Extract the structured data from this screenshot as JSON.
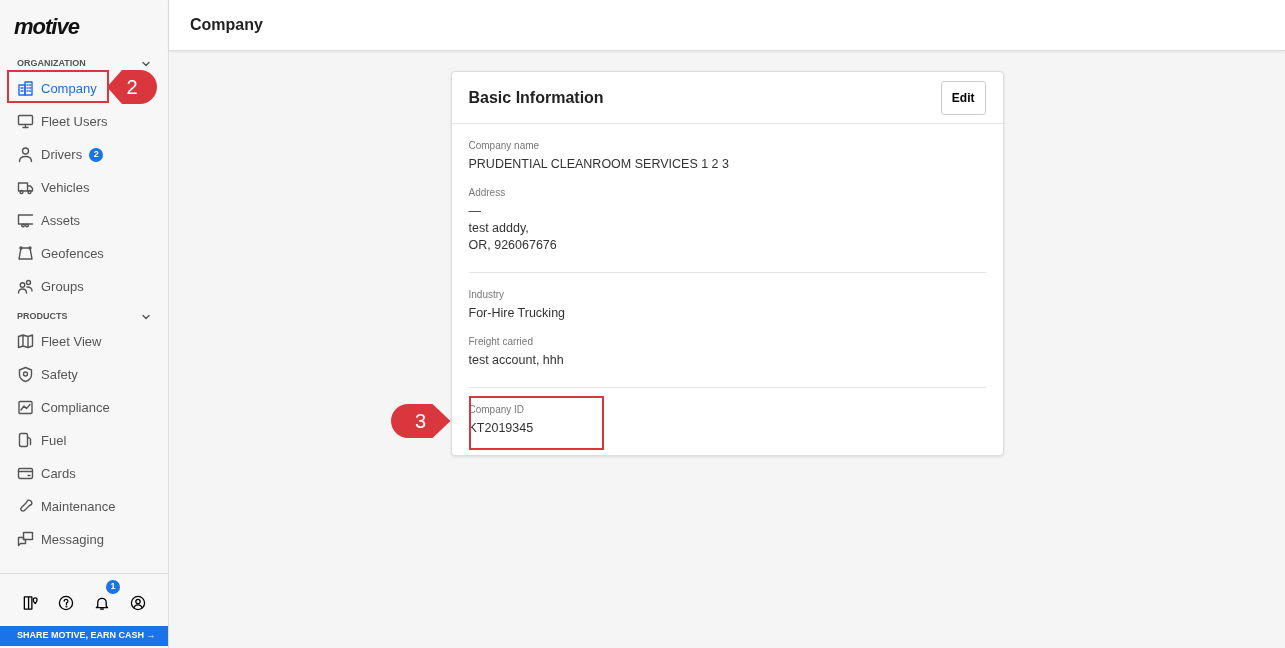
{
  "sidebar": {
    "logo": "motive",
    "sections": [
      {
        "heading": "ORGANIZATION",
        "expanded": true,
        "items": [
          {
            "label": "Company",
            "selected": true,
            "callout": "2"
          },
          {
            "label": "Fleet Users",
            "selected": false
          },
          {
            "label": "Drivers",
            "selected": false,
            "badge": "2"
          },
          {
            "label": "Vehicles",
            "selected": false
          },
          {
            "label": "Assets",
            "selected": false
          },
          {
            "label": "Geofences",
            "selected": false
          },
          {
            "label": "Groups",
            "selected": false
          }
        ]
      },
      {
        "heading": "PRODUCTS",
        "expanded": true,
        "items": [
          {
            "label": "Fleet View",
            "selected": false
          },
          {
            "label": "Safety",
            "selected": false
          },
          {
            "label": "Compliance",
            "selected": false
          },
          {
            "label": "Fuel",
            "selected": false
          },
          {
            "label": "Cards",
            "selected": false
          },
          {
            "label": "Maintenance",
            "selected": false
          },
          {
            "label": "Messaging",
            "selected": false
          }
        ]
      }
    ],
    "notification_badge": "1",
    "banner": "SHARE MOTIVE, EARN CASH →"
  },
  "page_title": "Company",
  "card": {
    "title": "Basic Information",
    "edit_button": "Edit",
    "sections": [
      {
        "fields": [
          {
            "label": "Company name",
            "lines": [
              "PRUDENTIAL CLEANROOM SERVICES 1 2 3"
            ]
          },
          {
            "label": "Address",
            "lines": [
              "—",
              "test adddy,",
              "OR, 926067676"
            ]
          }
        ]
      },
      {
        "fields": [
          {
            "label": "Industry",
            "lines": [
              "For-Hire Trucking"
            ]
          },
          {
            "label": "Freight carried",
            "lines": [
              "test account, hhh"
            ]
          }
        ]
      },
      {
        "callout": "3",
        "fields": [
          {
            "label": "Company ID",
            "lines": [
              "KT2019345"
            ]
          }
        ]
      }
    ]
  }
}
